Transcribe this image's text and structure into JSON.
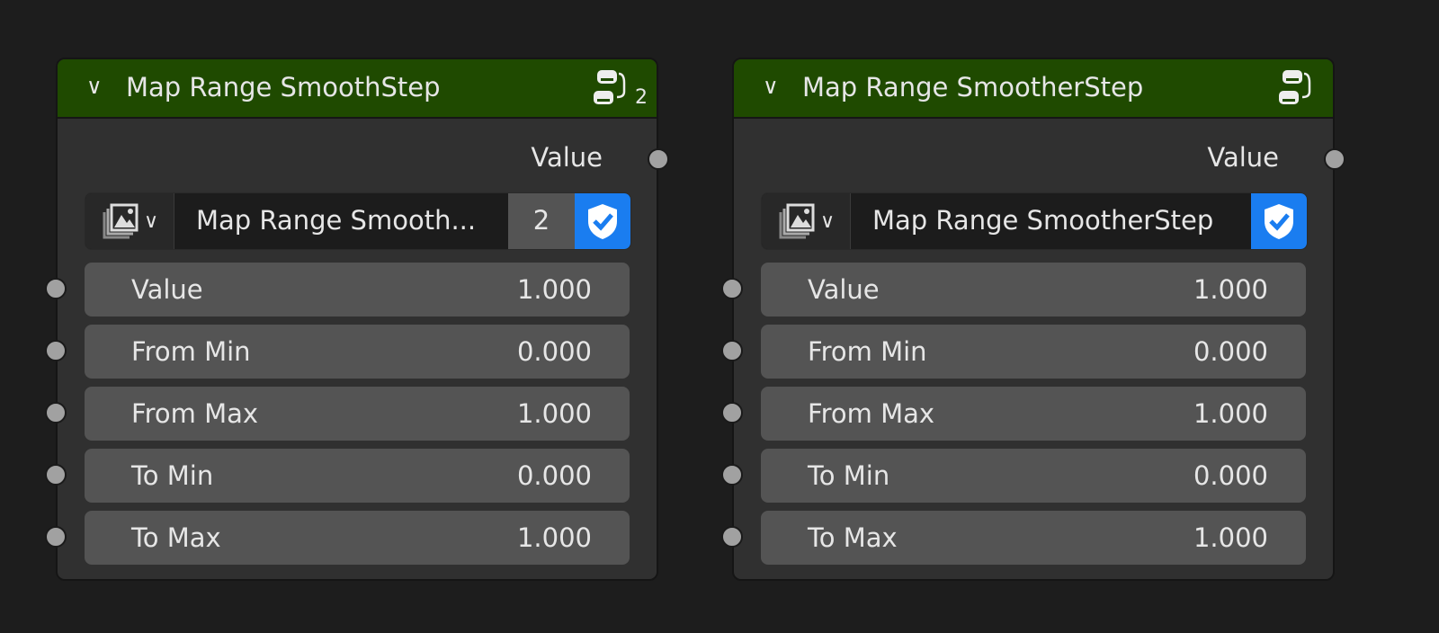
{
  "nodes": [
    {
      "title": "Map Range SmoothStep",
      "users_badge": "2",
      "output": "Value",
      "datablock": {
        "name": "Map Range Smooth...",
        "users": "2"
      },
      "inputs": [
        {
          "label": "Value",
          "value": "1.000"
        },
        {
          "label": "From Min",
          "value": "0.000"
        },
        {
          "label": "From Max",
          "value": "1.000"
        },
        {
          "label": "To Min",
          "value": "0.000"
        },
        {
          "label": "To Max",
          "value": "1.000"
        }
      ]
    },
    {
      "title": "Map Range SmootherStep",
      "output": "Value",
      "datablock": {
        "name": "Map Range SmootherStep"
      },
      "inputs": [
        {
          "label": "Value",
          "value": "1.000"
        },
        {
          "label": "From Min",
          "value": "0.000"
        },
        {
          "label": "From Max",
          "value": "1.000"
        },
        {
          "label": "To Min",
          "value": "0.000"
        },
        {
          "label": "To Max",
          "value": "1.000"
        }
      ]
    }
  ],
  "colors": {
    "header": "#1f4a00",
    "fake_user": "#1a7df0",
    "field": "#545454"
  }
}
